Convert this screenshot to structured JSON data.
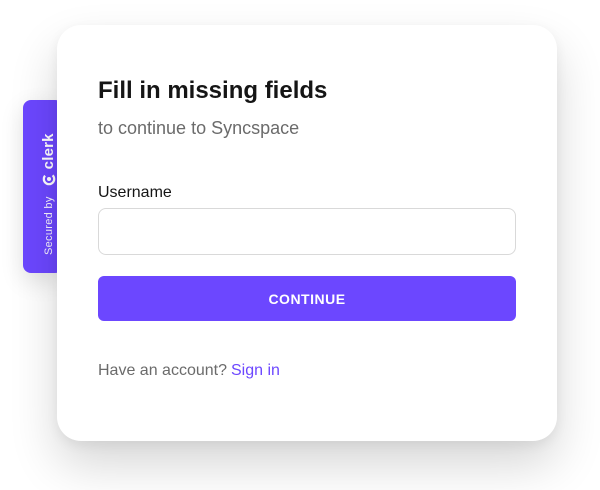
{
  "badge": {
    "secured_text": "Secured by",
    "brand_text": "clerk",
    "logo_icon": "clerk-logo-icon",
    "color": "#6c47ff"
  },
  "card": {
    "title": "Fill in missing fields",
    "subtitle": "to continue to Syncspace",
    "field": {
      "label": "Username",
      "value": "",
      "placeholder": ""
    },
    "continue_label": "CONTINUE",
    "footer": {
      "prompt": "Have an account?",
      "link": "Sign in"
    }
  },
  "colors": {
    "accent": "#6c47ff",
    "title": "#151515",
    "muted": "#6b6b6b",
    "border": "#d9d9d9"
  }
}
